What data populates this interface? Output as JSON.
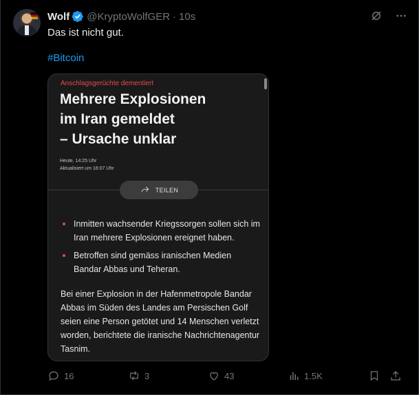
{
  "author": {
    "name": "Wolf",
    "handle": "@KryptoWolfGER",
    "separator": "·",
    "time": "10s"
  },
  "tweet": {
    "text": "Das ist nicht gut.",
    "hashtag": "#Bitcoin"
  },
  "card": {
    "kicker": "Anschlagsgerüchte dementiert",
    "headline_lines": [
      "Mehrere Explosionen",
      "im Iran gemeldet",
      "– Ursache unklar"
    ],
    "published": "Heute, 14:25 Uhr",
    "updated": "Aktualisiert um 16:07 Uhr",
    "share_label": "TEILEN",
    "bullets": [
      "Inmitten wachsender Kriegssorgen sollen sich im Iran mehrere Explosionen ereignet haben.",
      "Betroffen sind gemäss iranischen Medien Bandar Abbas und Teheran."
    ],
    "paragraph": "Bei einer Explosion in der Hafenmetropole Bandar Abbas im Süden des Landes am Persischen Golf seien eine Person getötet und 14 Menschen verletzt worden, berichtete die iranische Nachrichtenagentur Tasnim."
  },
  "actions": {
    "replies": "16",
    "reposts": "3",
    "likes": "43",
    "views": "1.5K"
  },
  "colors": {
    "background": "#000000",
    "accent": "#1d9bf0",
    "muted": "#71767b",
    "kicker_red": "#e8484c"
  },
  "icons": [
    "verified-badge-icon",
    "grok-icon",
    "more-icon",
    "share-arrow-icon",
    "reply-icon",
    "repost-icon",
    "like-icon",
    "views-icon",
    "bookmark-icon",
    "share-icon"
  ]
}
